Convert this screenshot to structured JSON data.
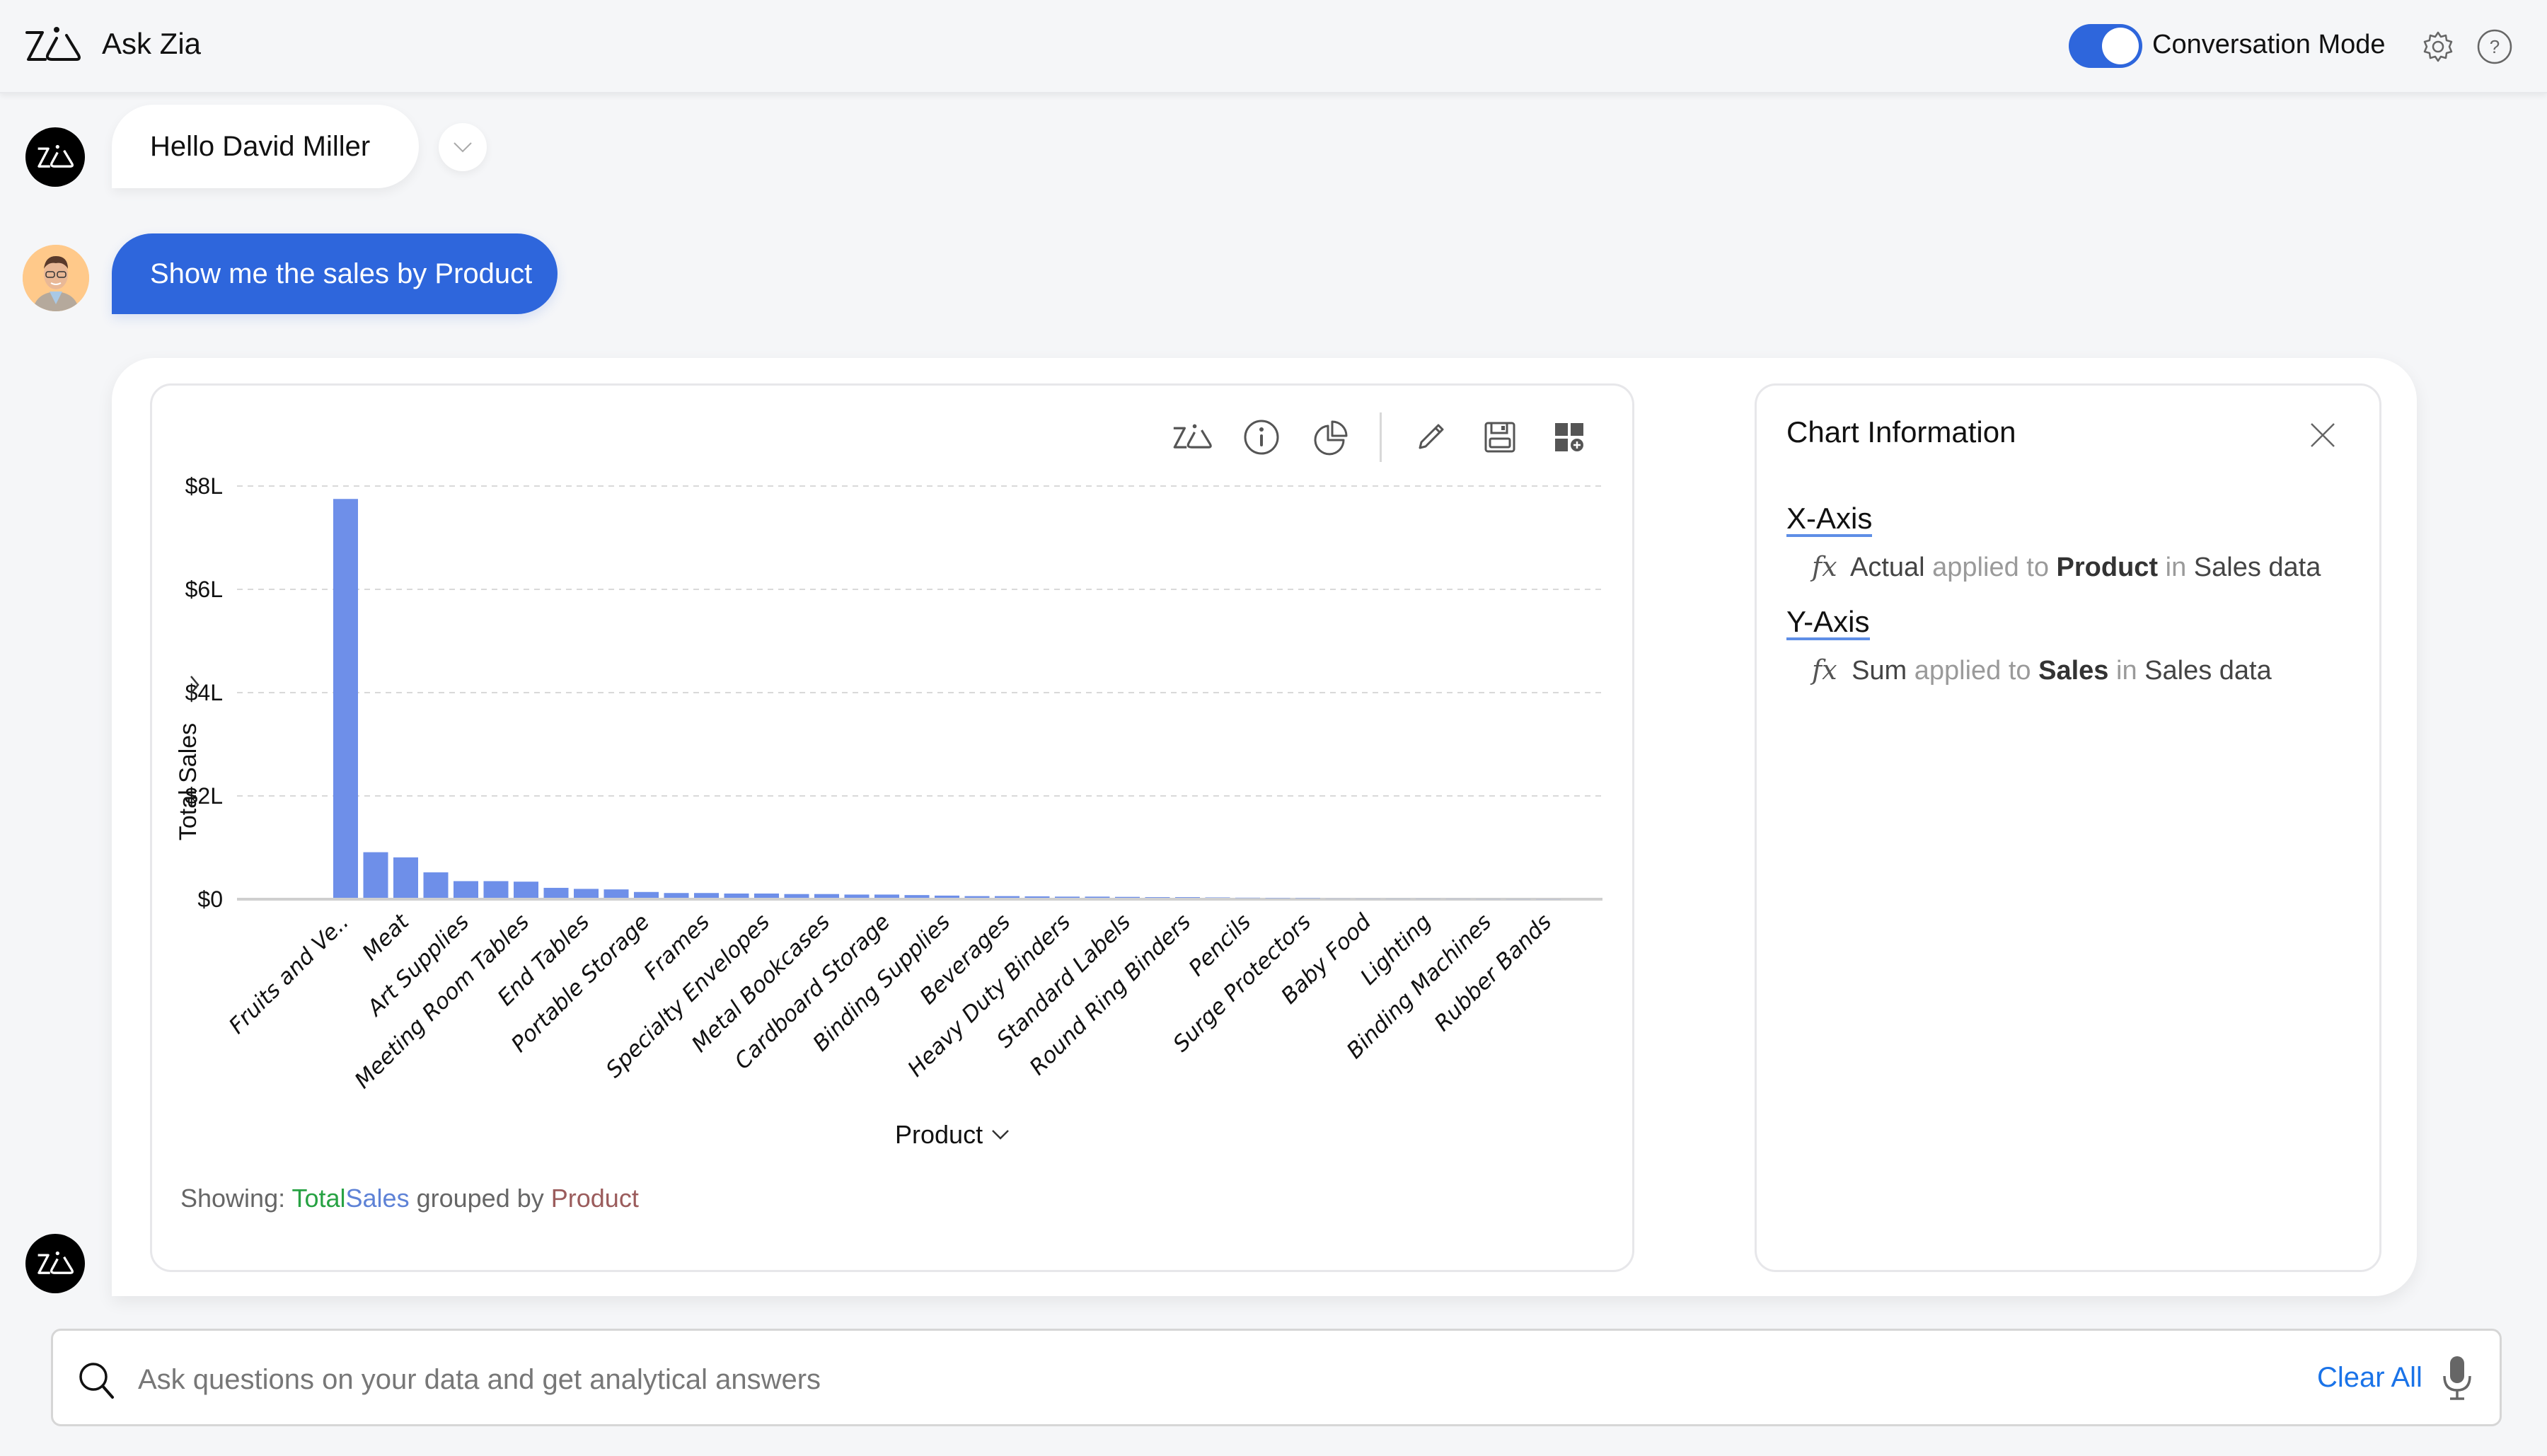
{
  "header": {
    "app_title": "Ask Zia",
    "conversation_mode_label": "Conversation Mode",
    "conversation_mode_on": true,
    "accent_color": "#2e66dc"
  },
  "messages": {
    "greeting": "Hello David Miller",
    "user_query": "Show me the sales by Product"
  },
  "chart_toolbar": {
    "icons": [
      "zia-icon",
      "info-icon",
      "chart-type-icon",
      "edit-icon",
      "save-icon",
      "add-to-dashboard-icon"
    ]
  },
  "chart_footer": {
    "showing_label": "Showing:",
    "measure_agg": "Total",
    "measure_field": "Sales",
    "grouped_by": "grouped by",
    "dimension": "Product"
  },
  "chart_info": {
    "title": "Chart Information",
    "x_axis": {
      "heading": "X-Axis",
      "fx": "fx",
      "function": "Actual",
      "applied_to": "applied to",
      "field": "Product",
      "in": "in",
      "table": "Sales data"
    },
    "y_axis": {
      "heading": "Y-Axis",
      "fx": "fx",
      "function": "Sum",
      "applied_to": "applied to",
      "field": "Sales",
      "in": "in",
      "table": "Sales data"
    }
  },
  "ask_bar": {
    "placeholder": "Ask questions on your data and get analytical answers",
    "value": "",
    "clear_all_label": "Clear All"
  },
  "chart_data": {
    "type": "bar",
    "title": "",
    "xlabel": "Product",
    "ylabel": "Total Sales",
    "ylim": [
      0,
      8
    ],
    "y_unit": "L",
    "y_ticks": [
      "$0",
      "$2L",
      "$4L",
      "$6L",
      "$8L"
    ],
    "y_tick_values": [
      0,
      2,
      4,
      6,
      8
    ],
    "grid": true,
    "bar_color": "#6e8fe9",
    "categories": [
      "Fruits and Ve..",
      "",
      "Meat",
      "",
      "Art Supplies",
      "",
      "Meeting Room Tables",
      "",
      "End Tables",
      "",
      "Portable Storage",
      "",
      "Frames",
      "",
      "Specialty Envelopes",
      "",
      "Metal Bookcases",
      "",
      "Cardboard Storage",
      "",
      "Binding Supplies",
      "",
      "Beverages",
      "",
      "Heavy Duty Binders",
      "",
      "Standard Labels",
      "",
      "Round Ring Binders",
      "",
      "Pencils",
      "",
      "Surge Protectors",
      "",
      "Baby Food",
      "",
      "Lighting",
      "",
      "Binding Machines",
      "",
      "Rubber Bands"
    ],
    "values": [
      7.75,
      0.91,
      0.81,
      0.52,
      0.35,
      0.35,
      0.34,
      0.22,
      0.2,
      0.19,
      0.14,
      0.12,
      0.12,
      0.11,
      0.11,
      0.1,
      0.1,
      0.09,
      0.09,
      0.08,
      0.07,
      0.06,
      0.06,
      0.055,
      0.05,
      0.05,
      0.045,
      0.04,
      0.04,
      0.035,
      0.03,
      0.025,
      0.02,
      0.015,
      0.012,
      0.01,
      0.008,
      0.006,
      0.004,
      0.003,
      0.002
    ]
  }
}
